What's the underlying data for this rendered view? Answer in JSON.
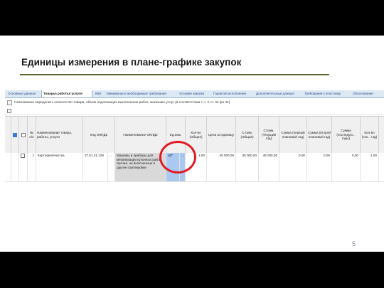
{
  "slide": {
    "title": "Единицы измерения в плане-графике закупок",
    "page_number": "5"
  },
  "tabs": [
    {
      "label": "Основные данные"
    },
    {
      "label": "Товары\\ работы\\ услуги"
    },
    {
      "label": "КБК"
    },
    {
      "label": "Минимально необходимые требования"
    },
    {
      "label": "Условия закупки"
    },
    {
      "label": "Гарантия исполнения"
    },
    {
      "label": "Дополнительные данные"
    },
    {
      "label": "Требования к участнику"
    },
    {
      "label": "Обоснование"
    }
  ],
  "active_tab": "Товары\\ работы\\ услуги",
  "warning": {
    "text": "Невозможно определить количество товара, объем подлежащих выполнению работ, оказанию услуг (в соответствии с ч. 2 ст. 42 фз 44)"
  },
  "table": {
    "headers": {
      "num": "№ п/п",
      "name": "Наименование товара, работы, услуги",
      "okpd_code": "Код ОКПД2",
      "okpd_name": "Наименование ОКПД2",
      "unit": "Ед.изм.",
      "qty_total": "Кол-во (Общее)",
      "price": "Цена за единицу",
      "cost_total": "Стоим. (Общая)",
      "cost_current": "Стоим. (Текущий год)",
      "sum_first": "Сумма (первый плановый год)",
      "sum_second": "Сумма (второй плановый год)",
      "sum_next": "Сумма (последую... годы)",
      "qty_current": "Кол-во (тек... год)"
    },
    "rows": [
      {
        "num": "1",
        "name": "Картофелечистка",
        "okpd_code": "27.51.21.129",
        "dots": "...",
        "okpd_name": "Машины и приборы для механизации кухонных работ прочие, не включенные в другие группировки",
        "unit": "ШТ",
        "qty_total": "1,00",
        "price": "45 000,00",
        "cost_total": "45 000,00",
        "cost_current": "45 000,00",
        "sum_first": "0,00",
        "sum_second": "0,00",
        "sum_next": "0,00",
        "qty_current": "1,00"
      }
    ]
  },
  "colors": {
    "highlight_circle": "#e01b24",
    "title_rule": "#5c6b2e",
    "tab_bar": "#dde8f5"
  }
}
